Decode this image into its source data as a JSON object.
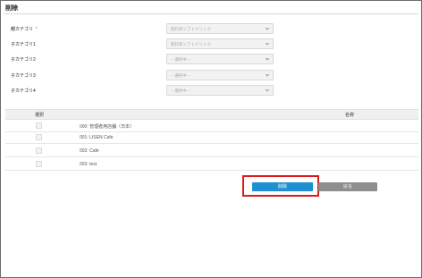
{
  "page": {
    "title": "削除"
  },
  "form": {
    "fields": [
      {
        "label": "親カテゴリ",
        "required_mark": "*",
        "value": "飲料系ソフトドリンク"
      },
      {
        "label": "子カテゴリ1",
        "required_mark": "",
        "value": "飲料系ソフトドリンク"
      },
      {
        "label": "子カテゴリ2",
        "required_mark": "",
        "value": "-- 選択中 --"
      },
      {
        "label": "子カテゴリ3",
        "required_mark": "",
        "value": "-- 選択中 --"
      },
      {
        "label": "子カテゴリ4",
        "required_mark": "",
        "value": "-- 選択中 --"
      }
    ]
  },
  "table": {
    "headers": {
      "select": "選択",
      "name": "名称"
    },
    "rows": [
      {
        "name": "000: 管理者用店舗（日本）"
      },
      {
        "name": "001: LISEN Cafe"
      },
      {
        "name": "002: Cafe"
      },
      {
        "name": "003: test"
      }
    ]
  },
  "actions": {
    "delete_label": "削除",
    "back_label": "戻る"
  },
  "colors": {
    "primary": "#1f8fd0",
    "secondary": "#8e8e8e",
    "highlight": "#e01818",
    "required": "#e05555"
  }
}
